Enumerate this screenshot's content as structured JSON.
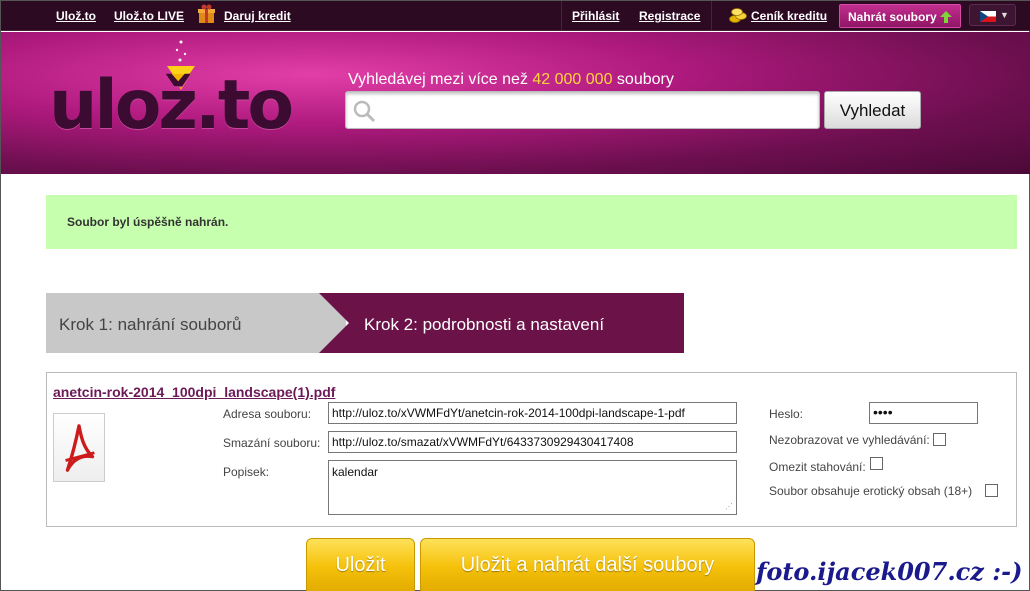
{
  "topnav": {
    "links": [
      "Ulož.to",
      "Ulož.to LIVE",
      "Daruj kredit"
    ],
    "login": "Přihlásit",
    "register": "Registrace",
    "credit_prices": "Ceník kreditu",
    "upload_files": "Nahrát soubory",
    "language_flag": "czech-flag",
    "language_caret": "▼"
  },
  "header": {
    "logo": "ulož.to",
    "tagline_before": "Vyhledávej mezi více než ",
    "tagline_count": "42 000 000",
    "tagline_after": " soubory",
    "search_value": "",
    "search_button": "Vyhledat"
  },
  "message": {
    "success": "Soubor byl úspěšně nahrán."
  },
  "steps": {
    "step1": "Krok 1: nahrání souborů",
    "step2": "Krok 2: podrobnosti a nastavení"
  },
  "file": {
    "name": "anetcin-rok-2014_100dpi_landscape(1).pdf",
    "icon": "pdf-icon",
    "address_label": "Adresa souboru:",
    "address_value": "http://uloz.to/xVWMFdYt/anetcin-rok-2014-100dpi-landscape-1-pdf",
    "delete_label": "Smazání souboru:",
    "delete_value": "http://uloz.to/smazat/xVWMFdYt/6433730929430417408",
    "description_label": "Popisek:",
    "description_value": "kalendar",
    "password_label": "Heslo:",
    "password_value": "••••",
    "hide_search_label": "Nezobrazovat ve vyhledávání:",
    "limit_download_label": "Omezit stahování:",
    "erotic_label": "Soubor obsahuje erotický obsah (18+)"
  },
  "actions": {
    "save": "Uložit",
    "save_and_upload": "Uložit a nahrát další soubory"
  },
  "watermark": "foto.ijacek007.cz :-)",
  "colors": {
    "brand_purple": "#6b1a57",
    "success_bg": "#c6ffad",
    "gold_button": "#f5c10a",
    "step_active": "#6b1248"
  }
}
